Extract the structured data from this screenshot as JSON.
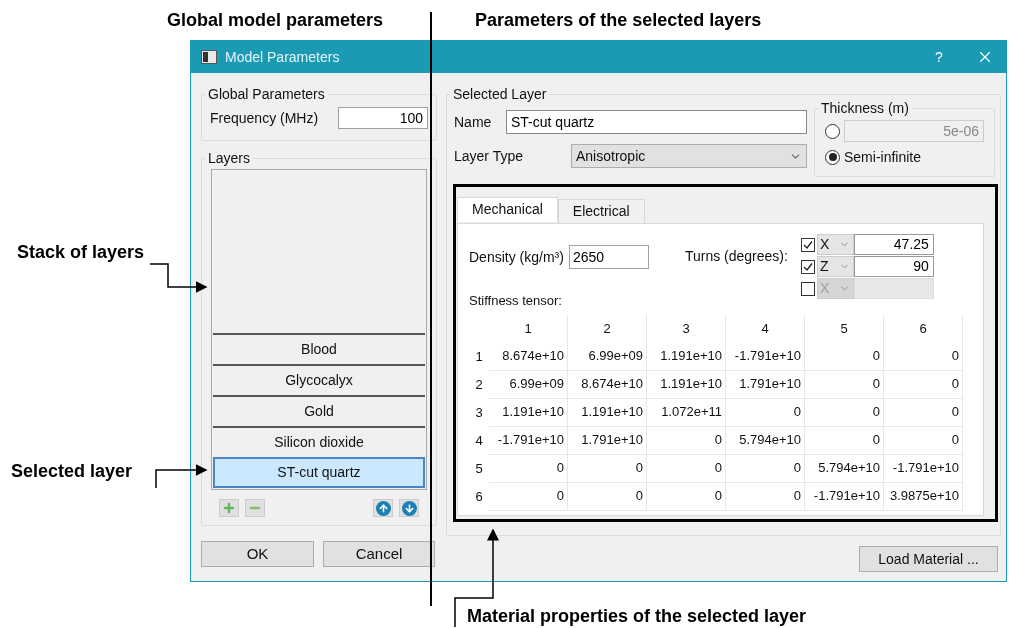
{
  "annotations": {
    "global_model": "Global model parameters",
    "selected_params": "Parameters of the selected layers",
    "stack": "Stack of layers",
    "selected_layer": "Selected layer",
    "material": "Material properties of the selected layer"
  },
  "dialog": {
    "title": "Model Parameters",
    "help": "?"
  },
  "global_parameters": {
    "title": "Global Parameters",
    "frequency_label": "Frequency (MHz)",
    "frequency_value": "100"
  },
  "layers": {
    "title": "Layers",
    "items": [
      {
        "name": "Blood",
        "selected": false
      },
      {
        "name": "Glycocalyx",
        "selected": false
      },
      {
        "name": "Gold",
        "selected": false
      },
      {
        "name": "Silicon dioxide",
        "selected": false
      },
      {
        "name": "ST-cut quartz",
        "selected": true
      }
    ]
  },
  "selected_layer": {
    "title": "Selected Layer",
    "name_label": "Name",
    "name_value": "ST-cut quartz",
    "type_label": "Layer Type",
    "type_value": "Anisotropic",
    "thickness": {
      "title": "Thickness (m)",
      "options": [
        {
          "kind": "value",
          "value": "5e-06",
          "selected": false
        },
        {
          "kind": "label",
          "label": "Semi-infinite",
          "selected": true
        }
      ]
    }
  },
  "tabs": [
    {
      "label": "Mechanical",
      "selected": true
    },
    {
      "label": "Electrical",
      "selected": false
    }
  ],
  "mechanical": {
    "density_label": "Density (kg/m³)",
    "density_value": "2650",
    "turns_label": "Turns (degrees):",
    "turns": [
      {
        "checked": true,
        "axis": "X",
        "value": "47.25"
      },
      {
        "checked": true,
        "axis": "Z",
        "value": "90"
      },
      {
        "checked": false,
        "axis": "X"
      }
    ],
    "stiffness_label": "Stiffness tensor:",
    "columns": [
      "1",
      "2",
      "3",
      "4",
      "5",
      "6"
    ],
    "rows": [
      {
        "header": "1",
        "cells": [
          "8.674e+10",
          "6.99e+09",
          "1.191e+10",
          "-1.791e+10",
          "0",
          "0"
        ]
      },
      {
        "header": "2",
        "cells": [
          "6.99e+09",
          "8.674e+10",
          "1.191e+10",
          "1.791e+10",
          "0",
          "0"
        ]
      },
      {
        "header": "3",
        "cells": [
          "1.191e+10",
          "1.191e+10",
          "1.072e+11",
          "0",
          "0",
          "0"
        ]
      },
      {
        "header": "4",
        "cells": [
          "-1.791e+10",
          "1.791e+10",
          "0",
          "5.794e+10",
          "0",
          "0"
        ]
      },
      {
        "header": "5",
        "cells": [
          "0",
          "0",
          "0",
          "0",
          "5.794e+10",
          "-1.791e+10"
        ]
      },
      {
        "header": "6",
        "cells": [
          "0",
          "0",
          "0",
          "0",
          "-1.791e+10",
          "3.9875e+10"
        ]
      }
    ]
  },
  "buttons": {
    "load": "Load Material ...",
    "ok": "OK",
    "cancel": "Cancel"
  }
}
